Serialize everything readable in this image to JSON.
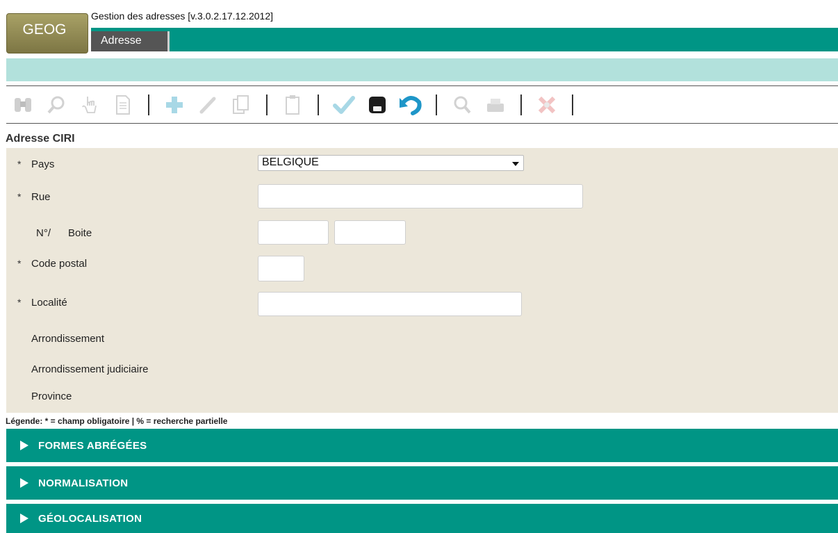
{
  "app": {
    "logo": "GEOG",
    "title": "Gestion des adresses [v.3.0.2.17.12.2012]",
    "tab": "Adresse"
  },
  "toolbar": {
    "icons": [
      "binoculars-icon",
      "search-icon",
      "pointer-hand-icon",
      "document-icon",
      "add-icon",
      "edit-pencil-icon",
      "copy-icon",
      "delete-clipboard-icon",
      "validate-check-icon",
      "save-icon",
      "undo-icon",
      "zoom-icon",
      "print-icon",
      "help-close-icon"
    ]
  },
  "section": {
    "title": "Adresse CIRI"
  },
  "form": {
    "required_mark": "*",
    "pays": {
      "label": "Pays",
      "value": "BELGIQUE"
    },
    "rue": {
      "label": "Rue",
      "value": ""
    },
    "numero": {
      "label": "N°/",
      "value": ""
    },
    "boite": {
      "label": "Boite",
      "value": ""
    },
    "code_postal": {
      "label": "Code postal",
      "value": ""
    },
    "localite": {
      "label": "Localité",
      "value": ""
    },
    "arrondissement": {
      "label": "Arrondissement"
    },
    "arrondissement_judiciaire": {
      "label": "Arrondissement judiciaire"
    },
    "province": {
      "label": "Province"
    }
  },
  "legend": "Légende: * = champ obligatoire | % = recherche partielle",
  "accordions": [
    {
      "label": "FORMES ABRÉGÉES"
    },
    {
      "label": "NORMALISATION"
    },
    {
      "label": "GÉOLOCALISATION"
    }
  ],
  "colors": {
    "teal": "#009585",
    "light_teal": "#b2e1dc",
    "form_bg": "#ece7da",
    "logo": "#8d8650",
    "tab_bg": "#555555"
  }
}
